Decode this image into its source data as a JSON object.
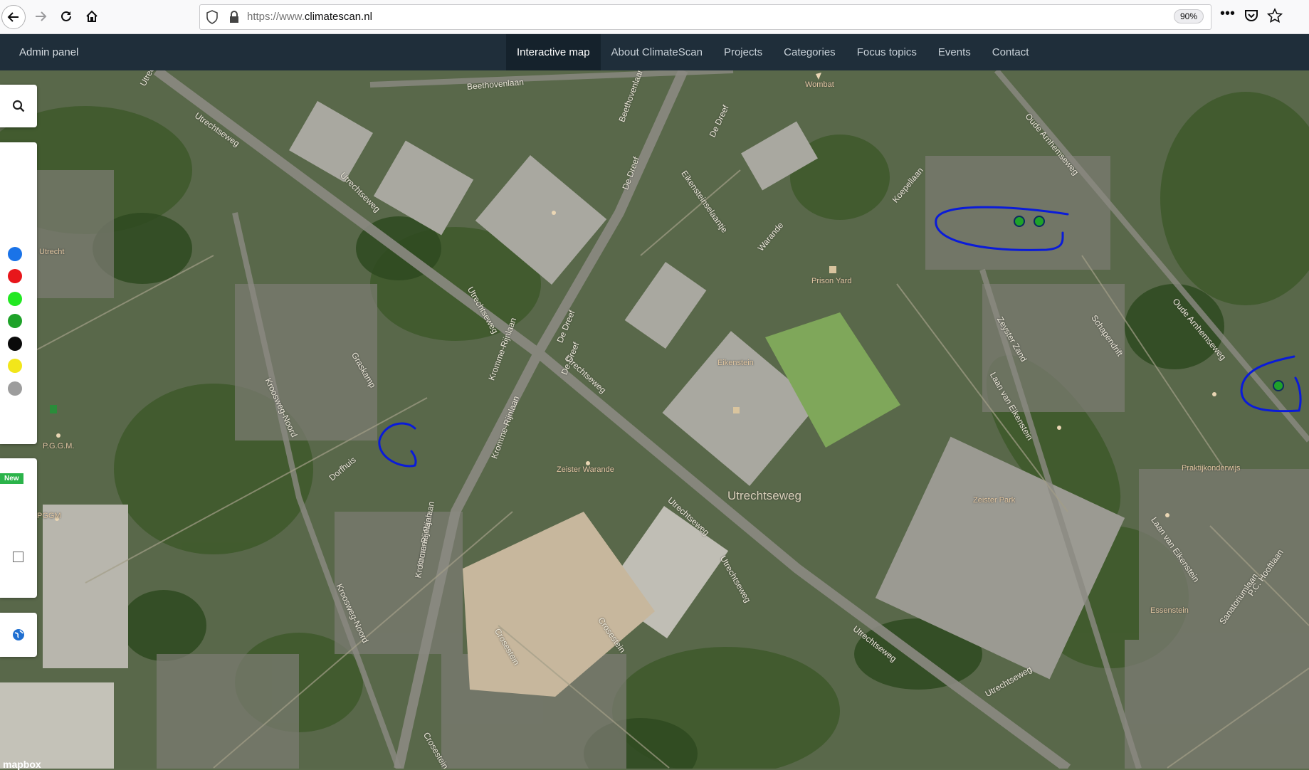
{
  "browser": {
    "url_prefix": "https://www.",
    "url_domain": "climatescan.nl",
    "zoom": "90%"
  },
  "header": {
    "admin_label": "Admin panel",
    "nav": [
      {
        "label": "Interactive map",
        "active": true
      },
      {
        "label": "About ClimateScan"
      },
      {
        "label": "Projects"
      },
      {
        "label": "Categories"
      },
      {
        "label": "Focus topics"
      },
      {
        "label": "Events"
      },
      {
        "label": "Contact"
      }
    ]
  },
  "legend": {
    "colors": [
      "#1a73e8",
      "#e8161b",
      "#22e822",
      "#1ea229",
      "#0a0a0a",
      "#f2e61a",
      "#9d9d9d"
    ]
  },
  "panel": {
    "new_badge": "New"
  },
  "map": {
    "labels": {
      "beethovenlaan": "Beethovenlaan",
      "utrechtseweg_nw": "Utrechtseweg",
      "utrechtseweg_a": "Utrechtseweg",
      "utrechtseweg_b": "Utrechtseweg",
      "utrechtseweg_main": "Utrechtseweg",
      "utrechtseweg_c": "Utrechtseweg",
      "utrechtseweg_big": "Utrechtseweg",
      "utrechtseweg_d": "Utrechtseweg",
      "utrechtseweg_e": "Utrechtseweg",
      "utrechtseweg_f": "Utrechtseweg",
      "de_dreef_1": "De Dreef",
      "de_dreef_2": "De Dreef",
      "de_dreef_3": "De Dreef",
      "kromme_rijnlaan_1": "Kromme-Rijnlaan",
      "kromme_rijnlaan_2": "Kromme-Rijnlaan",
      "kromme_rijnlaan_3": "Kromme-Rijnlaan",
      "kromme_rijnlaan_4": "Kromme-Rijnlaan",
      "kroosweg_noord_1": "Kroosweg-Noord",
      "kroosweg_noord_2": "Kroosweg-Noord",
      "graskamp": "Graskamp",
      "dorfhuis": "Dorfhuis",
      "warande": "Warande",
      "koepellaan": "Koepellaan",
      "oude_arnhemseweg_1": "Oude Arnhemseweg",
      "oude_arnhemseweg_2": "Oude Arnhemseweg",
      "zeyster_zand": "Zeyster Zand",
      "schapendrift": "Schapendrift",
      "laan_van_eikenstein_1": "Laan van Eikenstein",
      "laan_van_eikenstein_2": "Laan van Eikenstein",
      "crosestein_1": "Crosestein",
      "crosestein_2": "Crosestein",
      "crosestein_3": "Crosestein",
      "sanatoriumlaan": "Sanatoriumlaan",
      "pc_hooftlaan": "P.C. Hooftlaan",
      "eikensteinselaantje": "Eikensteinselaantje",
      "wombat": "Wombat",
      "prison_yard": "Prison Yard",
      "eikenstein": "Eikenstein",
      "zeister_warande": "Zeister Warande",
      "zeister_park": "Zeister Park",
      "praktijkonderwijs": "Praktijkonderwijs",
      "essenstein": "Essenstein",
      "utrecht": "Utrecht",
      "pgg_m_1": "P.G.G.M.",
      "pggm_2": "PGGM",
      "mapbox": "mapbox"
    }
  }
}
